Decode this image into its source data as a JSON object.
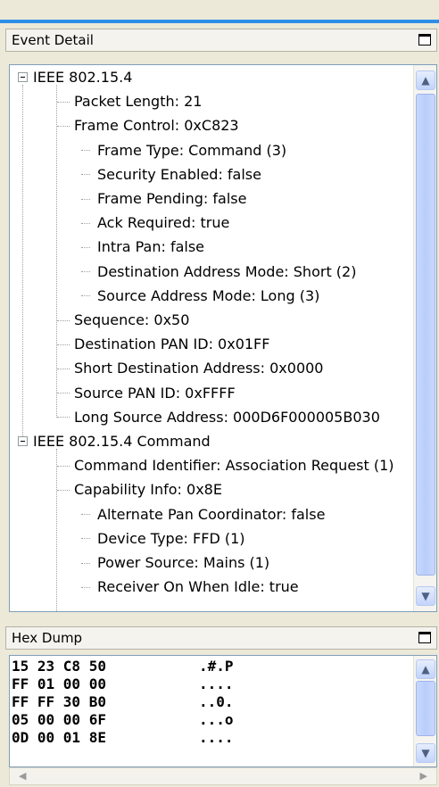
{
  "event_detail": {
    "title": "Event Detail",
    "tree": [
      {
        "level": 0,
        "label": "IEEE 802.15.4",
        "expander": true
      },
      {
        "level": 1,
        "label": "Packet Length: 21"
      },
      {
        "level": 1,
        "label": "Frame Control: 0xC823"
      },
      {
        "level": 2,
        "label": "Frame Type: Command (3)"
      },
      {
        "level": 2,
        "label": "Security Enabled: false"
      },
      {
        "level": 2,
        "label": "Frame Pending: false"
      },
      {
        "level": 2,
        "label": "Ack Required: true"
      },
      {
        "level": 2,
        "label": "Intra Pan: false"
      },
      {
        "level": 2,
        "label": "Destination Address Mode: Short (2)"
      },
      {
        "level": 2,
        "label": "Source Address Mode: Long (3)"
      },
      {
        "level": 1,
        "label": "Sequence: 0x50"
      },
      {
        "level": 1,
        "label": "Destination PAN ID: 0x01FF"
      },
      {
        "level": 1,
        "label": "Short Destination Address: 0x0000"
      },
      {
        "level": 1,
        "label": "Source PAN ID: 0xFFFF"
      },
      {
        "level": 1,
        "label": "Long Source Address: 000D6F000005B030"
      },
      {
        "level": 0,
        "label": "IEEE 802.15.4 Command",
        "expander": true
      },
      {
        "level": 1,
        "label": "Command Identifier: Association Request (1)"
      },
      {
        "level": 1,
        "label": "Capability Info: 0x8E"
      },
      {
        "level": 2,
        "label": "Alternate Pan Coordinator: false"
      },
      {
        "level": 2,
        "label": "Device Type: FFD (1)"
      },
      {
        "level": 2,
        "label": "Power Source: Mains (1)"
      },
      {
        "level": 2,
        "label": "Receiver On When Idle: true"
      }
    ]
  },
  "hex_dump": {
    "title": "Hex Dump",
    "rows": [
      {
        "bytes": "15 23 C8 50",
        "ascii": ".#.P"
      },
      {
        "bytes": "FF 01 00 00",
        "ascii": "...."
      },
      {
        "bytes": "FF FF 30 B0",
        "ascii": "..0."
      },
      {
        "bytes": "05 00 00 6F",
        "ascii": "...o"
      },
      {
        "bytes": "0D 00 01 8E",
        "ascii": "...."
      }
    ]
  },
  "colors": {
    "accent": "#2f8fe8",
    "panel_background": "#ece9d8",
    "border": "#7f9db9"
  },
  "icons": {
    "panel_restore": "restore-icon",
    "scroll_up": "scroll-up-icon",
    "scroll_down": "scroll-down-icon",
    "scroll_left": "scroll-left-icon",
    "scroll_right": "scroll-right-icon"
  }
}
